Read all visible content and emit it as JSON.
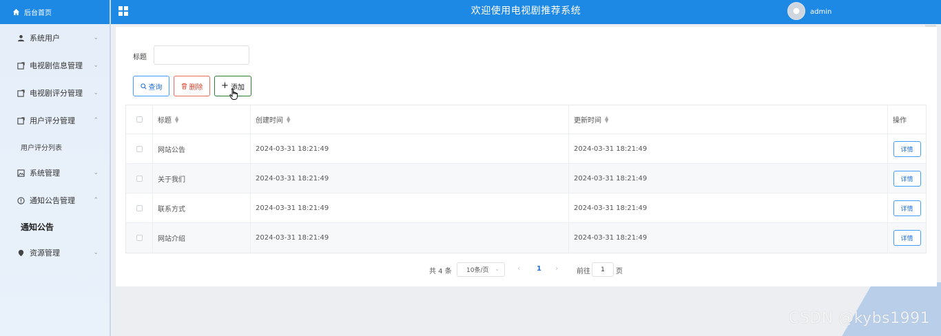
{
  "sidebar": {
    "home_label": "后台首页",
    "items": [
      {
        "label": "系统用户",
        "icon": "user-icon",
        "expanded": false
      },
      {
        "label": "电视剧信息管理",
        "icon": "doc-icon",
        "expanded": false
      },
      {
        "label": "电视剧评分管理",
        "icon": "doc-icon",
        "expanded": false
      },
      {
        "label": "用户评分管理",
        "icon": "doc-icon",
        "expanded": true
      },
      {
        "label": "系统管理",
        "icon": "image-icon",
        "expanded": false
      },
      {
        "label": "通知公告管理",
        "icon": "info-icon",
        "expanded": true
      },
      {
        "label": "资源管理",
        "icon": "location-icon",
        "expanded": false
      }
    ],
    "sub_items": {
      "user_rating_list": "用户评分列表",
      "notice": "通知公告"
    }
  },
  "header": {
    "title": "欢迎使用电视剧推荐系统",
    "username": "admin"
  },
  "search": {
    "label": "标题",
    "value": "",
    "query_label": "查询",
    "delete_label": "删除",
    "add_label": "添加"
  },
  "table": {
    "headers": {
      "title": "标题",
      "created": "创建时间",
      "updated": "更新时间",
      "actions": "操作"
    },
    "rows": [
      {
        "title": "网站公告",
        "created": "2024-03-31 18:21:49",
        "updated": "2024-03-31 18:21:49",
        "action": "详情"
      },
      {
        "title": "关于我们",
        "created": "2024-03-31 18:21:49",
        "updated": "2024-03-31 18:21:49",
        "action": "详情"
      },
      {
        "title": "联系方式",
        "created": "2024-03-31 18:21:49",
        "updated": "2024-03-31 18:21:49",
        "action": "详情"
      },
      {
        "title": "网站介绍",
        "created": "2024-03-31 18:21:49",
        "updated": "2024-03-31 18:21:49",
        "action": "详情"
      }
    ]
  },
  "pagination": {
    "total": "共 4 条",
    "page_size": "10条/页",
    "current": "1",
    "goto_label": "前往",
    "goto_value": "1",
    "page_suffix": "页"
  },
  "watermark": "CSDN @kybs1991",
  "colors": {
    "primary": "#1e88e5",
    "danger": "#d9432f",
    "success_border": "#2e7d32"
  }
}
